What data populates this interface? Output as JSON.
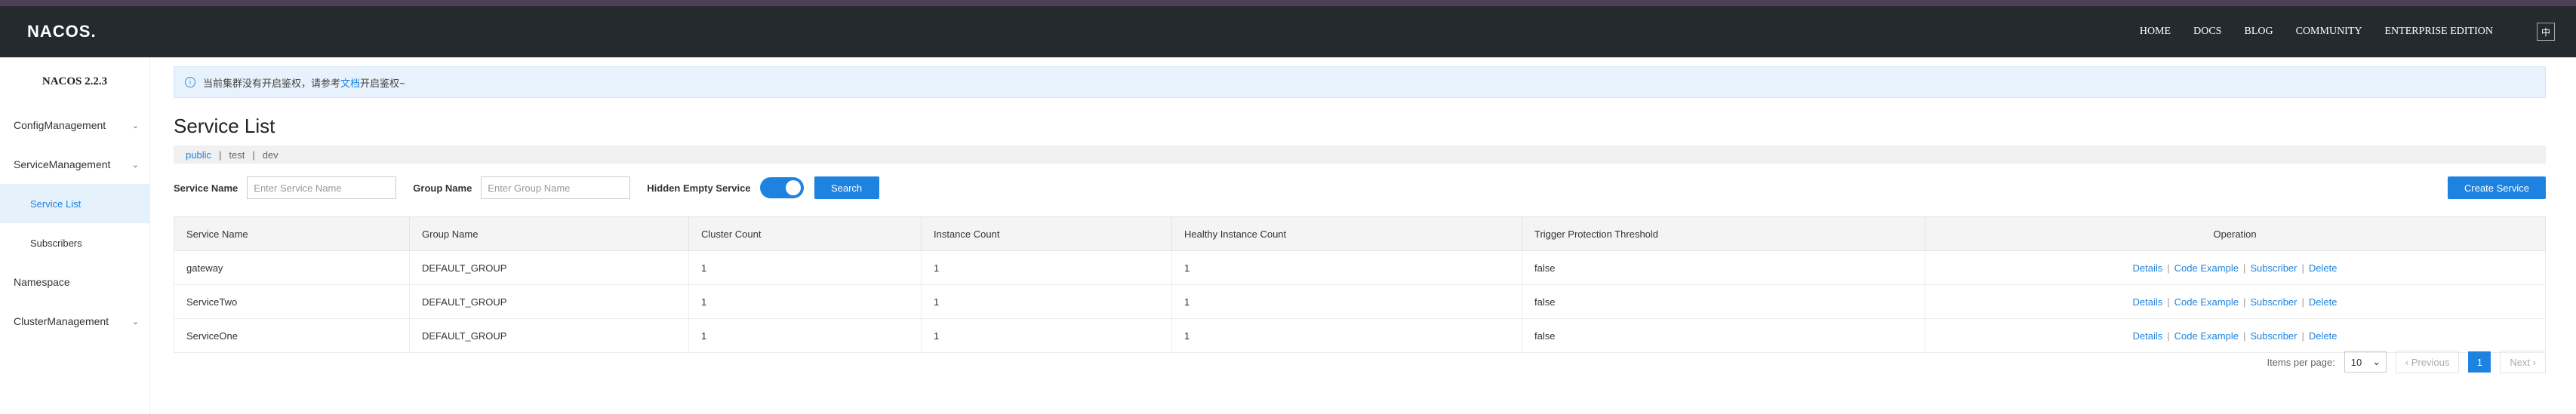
{
  "header": {
    "logo": "NACOS.",
    "nav": [
      "HOME",
      "DOCS",
      "BLOG",
      "COMMUNITY",
      "ENTERPRISE EDITION"
    ],
    "lang": "中"
  },
  "sidebar": {
    "version": "NACOS 2.2.3",
    "items": [
      {
        "label": "ConfigManagement"
      },
      {
        "label": "ServiceManagement"
      },
      {
        "label": "Service List"
      },
      {
        "label": "Subscribers"
      },
      {
        "label": "Namespace"
      },
      {
        "label": "ClusterManagement"
      }
    ]
  },
  "alert": {
    "text_before": "当前集群没有开启鉴权，请参考",
    "link": "文档",
    "text_after": "开启鉴权~"
  },
  "page_title": "Service List",
  "namespaces": [
    "public",
    "test",
    "dev"
  ],
  "filters": {
    "service_name_label": "Service Name",
    "service_name_placeholder": "Enter Service Name",
    "group_name_label": "Group Name",
    "group_name_placeholder": "Enter Group Name",
    "hidden_empty_label": "Hidden Empty Service",
    "search_button": "Search",
    "create_button": "Create Service"
  },
  "table": {
    "headers": [
      "Service Name",
      "Group Name",
      "Cluster Count",
      "Instance Count",
      "Healthy Instance Count",
      "Trigger Protection Threshold",
      "Operation"
    ],
    "rows": [
      [
        "gateway",
        "DEFAULT_GROUP",
        "1",
        "1",
        "1",
        "false"
      ],
      [
        "ServiceTwo",
        "DEFAULT_GROUP",
        "1",
        "1",
        "1",
        "false"
      ],
      [
        "ServiceOne",
        "DEFAULT_GROUP",
        "1",
        "1",
        "1",
        "false"
      ]
    ],
    "ops": [
      "Details",
      "Code Example",
      "Subscriber",
      "Delete"
    ]
  },
  "pagination": {
    "per_page_label": "Items per page:",
    "per_page_value": "10",
    "prev": "Previous",
    "current": "1",
    "next": "Next"
  },
  "colors": {
    "accent": "#1e83e0",
    "topbar": "#252a2f"
  }
}
